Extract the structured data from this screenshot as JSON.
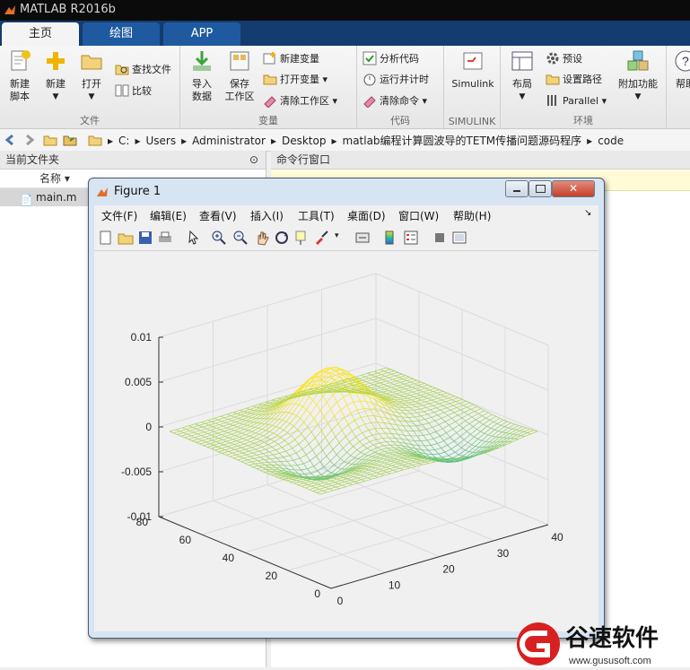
{
  "app": {
    "title": "MATLAB R2016b"
  },
  "tabs": [
    {
      "label": "主页",
      "active": true
    },
    {
      "label": "绘图",
      "active": false
    },
    {
      "label": "APP",
      "active": false
    }
  ],
  "ribbon": {
    "file": {
      "label": "文件",
      "new_script": "新建\n脚本",
      "new": "新建",
      "open": "打开",
      "find_files": "查找文件",
      "compare": "比较"
    },
    "variable": {
      "label": "变量",
      "import": "导入\n数据",
      "save_ws": "保存\n工作区",
      "new_var": "新建变量",
      "open_var": "打开变量",
      "clear_ws": "清除工作区"
    },
    "code": {
      "label": "代码",
      "analyze": "分析代码",
      "run_time": "运行并计时",
      "clear_cmd": "清除命令"
    },
    "simulink": {
      "label": "SIMULINK",
      "btn": "Simulink"
    },
    "env": {
      "label": "环境",
      "layout": "布局",
      "prefs": "预设",
      "set_path": "设置路径",
      "parallel": "Parallel",
      "addons": "附加功能"
    },
    "help": {
      "label": "帮助"
    }
  },
  "address": {
    "crumbs": [
      "C:",
      "Users",
      "Administrator",
      "Desktop",
      "matlab编程计算圆波导的TETM传播问题源码程序",
      "code"
    ]
  },
  "current_folder": {
    "title": "当前文件夹",
    "col_name": "名称",
    "files": [
      "main.m"
    ]
  },
  "command_window": {
    "title": "命令行窗口"
  },
  "figure": {
    "title": "Figure 1",
    "menus": [
      "文件(F)",
      "编辑(E)",
      "查看(V)",
      "插入(I)",
      "工具(T)",
      "桌面(D)",
      "窗口(W)",
      "帮助(H)"
    ],
    "z_ticks": [
      "0.01",
      "0.005",
      "0",
      "-0.005",
      "-0.01"
    ],
    "x_ticks": [
      "0",
      "10",
      "20",
      "30",
      "40"
    ],
    "y_ticks": [
      "0",
      "20",
      "40",
      "60",
      "80"
    ]
  },
  "chart_data": {
    "type": "mesh-3d",
    "title": "",
    "x_range": [
      0,
      40
    ],
    "y_range": [
      0,
      80
    ],
    "z_range": [
      -0.01,
      0.01
    ],
    "peaks": [
      {
        "x": 20,
        "y": 50,
        "z": 0.006
      },
      {
        "x": 30,
        "y": 20,
        "z": -0.003
      }
    ],
    "colormap": "parula"
  },
  "watermark": {
    "text": "谷速软件",
    "url": "www.gususoft.com"
  }
}
